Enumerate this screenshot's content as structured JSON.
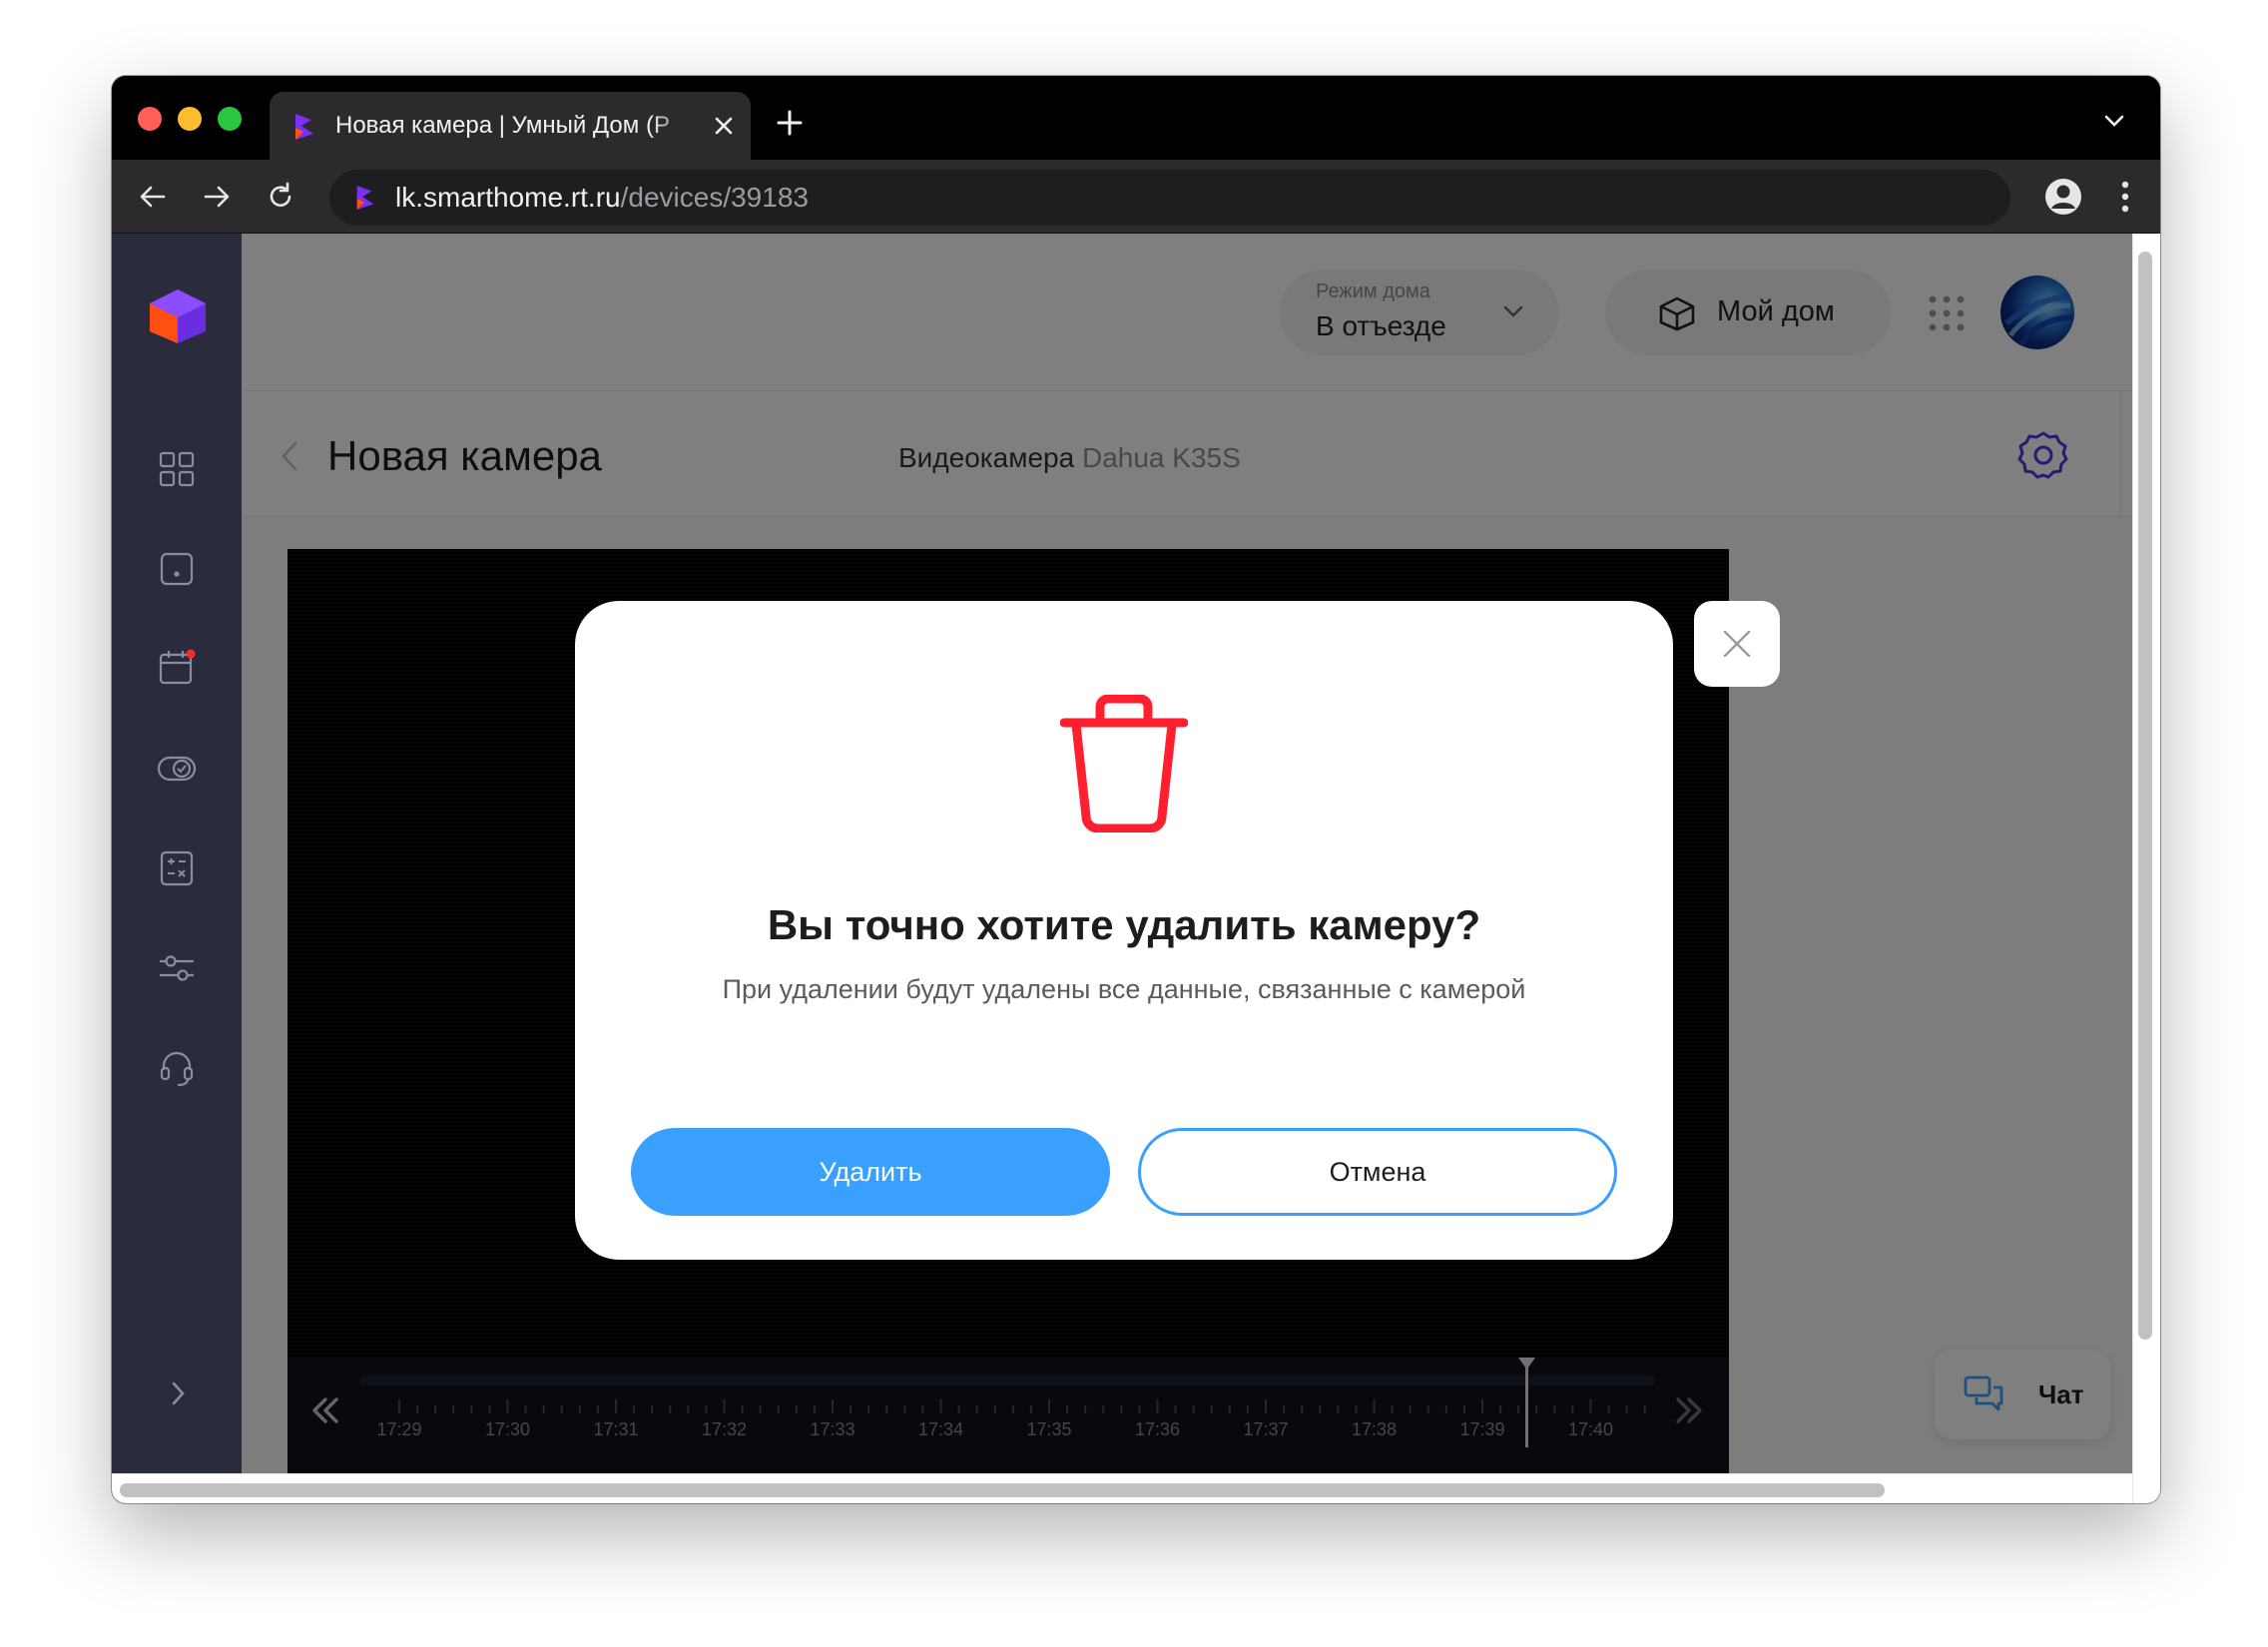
{
  "browser": {
    "tab_title": "Новая камера | Умный Дом (Р",
    "url_host": "lk.smarthome.rt.ru",
    "url_path": "/devices/39183"
  },
  "header": {
    "mode_label": "Режим дома",
    "mode_value": "В отъезде",
    "home_label": "Мой дом"
  },
  "subheader": {
    "title": "Новая камера",
    "device_type": "Видеокамера",
    "device_model": "Dahua K35S"
  },
  "timeline": {
    "labels": [
      "17:29",
      "17:30",
      "17:31",
      "17:32",
      "17:33",
      "17:34",
      "17:35",
      "17:36",
      "17:37",
      "17:38",
      "17:39",
      "17:40"
    ]
  },
  "chat": {
    "label": "Чат"
  },
  "modal": {
    "title": "Вы точно хотите удалить камеру?",
    "text": "При удалении будут удалены все данные, связанные с камерой",
    "delete_label": "Удалить",
    "cancel_label": "Отмена"
  },
  "colors": {
    "accent": "#3aa0ff",
    "danger": "#ff1f2f",
    "brand": "#7b2ff7",
    "icon_purple": "#5a2ee8"
  },
  "icons": {
    "sidebar": [
      "dashboard-grid-icon",
      "device-icon",
      "calendar-events-icon",
      "scenarios-toggle-icon",
      "calculator-icon",
      "sliders-icon",
      "support-headset-icon"
    ]
  }
}
